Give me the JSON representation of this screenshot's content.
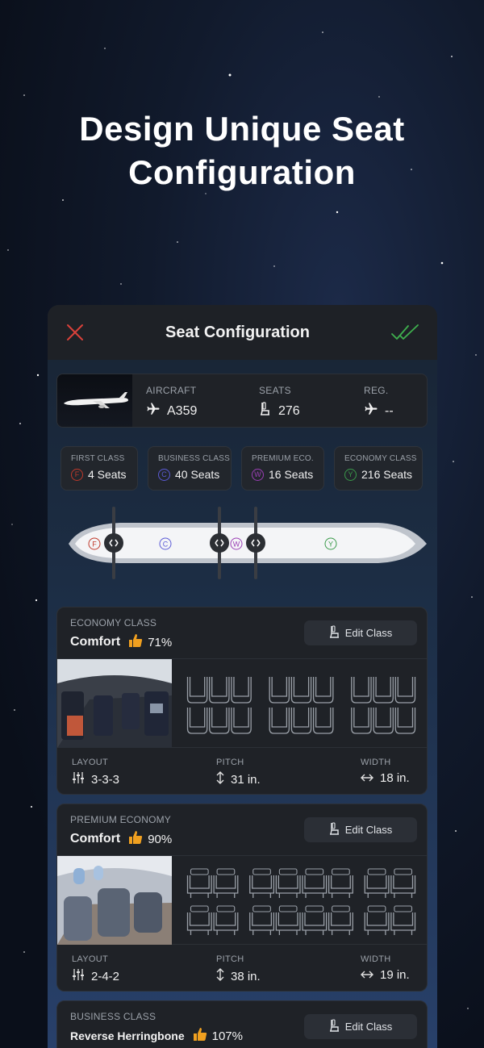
{
  "headline": {
    "line1": "Design Unique Seat",
    "line2": "Configuration"
  },
  "topbar": {
    "title": "Seat Configuration",
    "close_icon": "close-icon",
    "confirm_icon": "double-check-icon"
  },
  "aircraft": {
    "aircraft_label": "AIRCRAFT",
    "aircraft_value": "A359",
    "seats_label": "SEATS",
    "seats_value": "276",
    "reg_label": "REG.",
    "reg_value": "--"
  },
  "classes": [
    {
      "label": "FIRST CLASS",
      "badge": "F",
      "value": "4 Seats",
      "color": "#c0392b"
    },
    {
      "label": "BUSINESS CLASS",
      "badge": "C",
      "value": "40 Seats",
      "color": "#5b5bd6"
    },
    {
      "label": "PREMIUM ECO.",
      "badge": "W",
      "value": "16 Seats",
      "color": "#9b3fb5"
    },
    {
      "label": "ECONOMY CLASS",
      "badge": "Y",
      "value": "216 Seats",
      "color": "#3a9a4a"
    }
  ],
  "fuselage": {
    "badges": [
      "F",
      "C",
      "W",
      "Y"
    ]
  },
  "cards": [
    {
      "class_label": "ECONOMY CLASS",
      "name": "Comfort",
      "percent": "71%",
      "edit_label": "Edit Class",
      "layout_label": "LAYOUT",
      "layout_value": "3-3-3",
      "pitch_label": "PITCH",
      "pitch_value": "31 in.",
      "width_label": "WIDTH",
      "width_value": "18 in."
    },
    {
      "class_label": "PREMIUM ECONOMY",
      "name": "Comfort",
      "percent": "90%",
      "edit_label": "Edit Class",
      "layout_label": "LAYOUT",
      "layout_value": "2-4-2",
      "pitch_label": "PITCH",
      "pitch_value": "38 in.",
      "width_label": "WIDTH",
      "width_value": "19 in."
    },
    {
      "class_label": "BUSINESS CLASS",
      "name": "Reverse Herringbone",
      "percent": "107%",
      "edit_label": "Edit Class"
    }
  ]
}
